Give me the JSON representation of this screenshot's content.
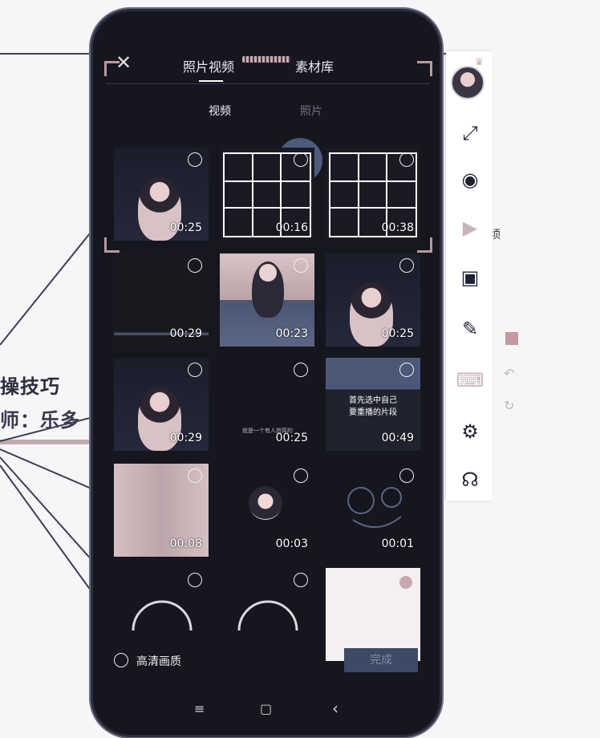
{
  "background": {
    "slide_title": "操技巧",
    "slide_subtitle": "师：乐多",
    "fragment_right": "顷"
  },
  "picker": {
    "tabs": [
      {
        "label": "照片视频",
        "active": true
      },
      {
        "label": "素材库",
        "active": false
      }
    ],
    "sub_tabs": [
      {
        "label": "视频",
        "active": true
      },
      {
        "label": "照片",
        "active": false
      }
    ],
    "items": [
      {
        "duration": "00:25",
        "kind": "person"
      },
      {
        "duration": "00:16",
        "kind": "grid"
      },
      {
        "duration": "00:38",
        "kind": "grid"
      },
      {
        "duration": "00:29",
        "kind": "dark"
      },
      {
        "duration": "00:23",
        "kind": "room"
      },
      {
        "duration": "00:25",
        "kind": "person"
      },
      {
        "duration": "00:29",
        "kind": "person"
      },
      {
        "duration": "00:25",
        "kind": "subtitle",
        "caption": "就是一个有人指挥的"
      },
      {
        "duration": "00:49",
        "kind": "tutorial",
        "caption": "首先选中自己\n要重播的片段"
      },
      {
        "duration": "00:08",
        "kind": "door"
      },
      {
        "duration": "00:03",
        "kind": "avatar"
      },
      {
        "duration": "00:01",
        "kind": "sketch"
      },
      {
        "duration": "",
        "kind": "gauge"
      },
      {
        "duration": "",
        "kind": "gauge"
      },
      {
        "duration": "",
        "kind": "doc"
      }
    ],
    "hd_label": "高清画质",
    "confirm_label": "完成"
  },
  "nav": {
    "menu": "≡",
    "home": "▢",
    "back": "‹"
  },
  "toolbar": {
    "tools": [
      {
        "name": "avatar"
      },
      {
        "name": "fullscreen-icon",
        "glyph": "⤢"
      },
      {
        "name": "camera-icon",
        "glyph": "◉"
      },
      {
        "name": "video-camera-icon",
        "glyph": "▶"
      },
      {
        "name": "screen-cast-icon",
        "glyph": "▣"
      },
      {
        "name": "pen-icon",
        "glyph": "✎"
      },
      {
        "name": "keyboard-icon",
        "glyph": "⌨"
      },
      {
        "name": "settings-icon",
        "glyph": "⚙"
      },
      {
        "name": "headset-icon",
        "glyph": "☊"
      }
    ]
  },
  "colors": {
    "phone_bg": "#16161f",
    "accent": "#b99a9f",
    "confirm": "#3d4a66"
  }
}
